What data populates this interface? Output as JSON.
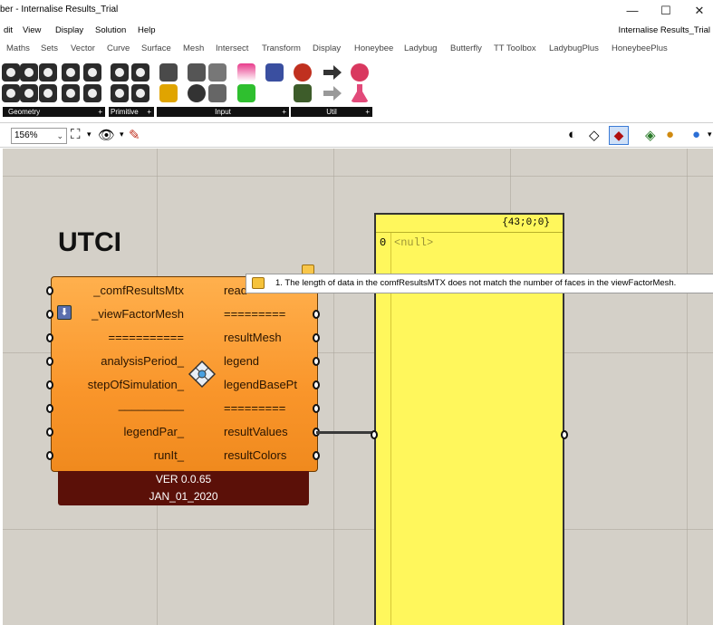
{
  "window": {
    "title": "ber - Internalise Results_Trial",
    "minimize": "—",
    "maximize": "☐",
    "close": "✕"
  },
  "menu": {
    "items": [
      "dit",
      "View",
      "Display",
      "Solution",
      "Help"
    ],
    "document": "Internalise Results_Trial"
  },
  "tabs": [
    "Maths",
    "Sets",
    "Vector",
    "Curve",
    "Surface",
    "Mesh",
    "Intersect",
    "Transform",
    "Display",
    "Honeybee",
    "Ladybug",
    "Butterfly",
    "TT Toolbox",
    "LadybugPlus",
    "HoneybeePlus"
  ],
  "ribbon": {
    "groups": [
      {
        "label": "Geometry",
        "plus": "+"
      },
      {
        "label": "Primitive",
        "plus": "+"
      },
      {
        "label": "Input",
        "plus": "+"
      },
      {
        "label": "Util",
        "plus": "+"
      }
    ]
  },
  "canvas_toolbar": {
    "zoom": "156%"
  },
  "canvas": {
    "group_title": "UTCI",
    "component": {
      "inputs": [
        "_comfResultsMtx",
        "_viewFactorMesh",
        "===========",
        "analysisPeriod_",
        "stepOfSimulation_",
        "__________",
        "legendPar_",
        "runIt_"
      ],
      "outputs": [
        "read",
        "=========",
        "resultMesh",
        "legend",
        "legendBasePt",
        "=========",
        "resultValues",
        "resultColors"
      ],
      "version": "VER 0.0.65",
      "date": "JAN_01_2020"
    },
    "panel": {
      "header": "{43;0;0}",
      "index": "0",
      "value": "<null>"
    },
    "tooltip": "1. The length of data in the comfResultsMTX does not match the number of faces in the viewFactorMesh."
  }
}
